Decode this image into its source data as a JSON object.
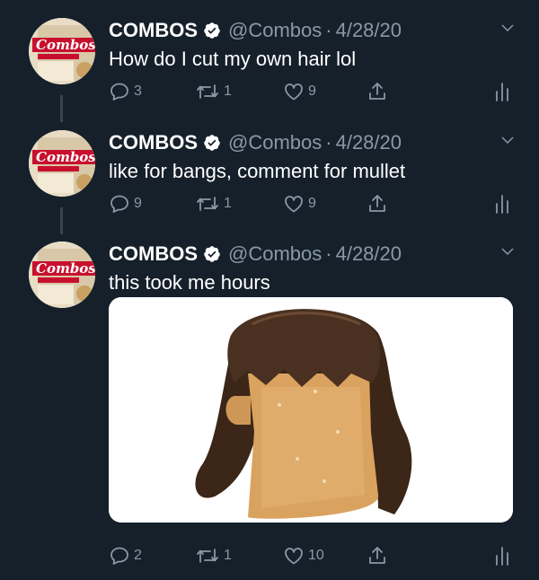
{
  "colors": {
    "background": "#15202b",
    "primary_text": "#ffffff",
    "secondary_text": "#8899a6",
    "verified_badge": "#ffffff",
    "thread_line": "#38444d"
  },
  "avatar": {
    "brand_text": "Combos",
    "sub_text": "STUFFED SNACKS",
    "flavor_text": "Spicy Honey Mustard"
  },
  "tweets": [
    {
      "name": "COMBOS",
      "handle": "@Combos",
      "separator": "·",
      "date": "4/28/20",
      "text": "How do I cut my own hair lol",
      "replies": "3",
      "retweets": "1",
      "likes": "9"
    },
    {
      "name": "COMBOS",
      "handle": "@Combos",
      "separator": "·",
      "date": "4/28/20",
      "text": "like for bangs, comment for mullet",
      "replies": "9",
      "retweets": "1",
      "likes": "9"
    },
    {
      "name": "COMBOS",
      "handle": "@Combos",
      "separator": "·",
      "date": "4/28/20",
      "text": "this took me hours",
      "replies": "2",
      "retweets": "1",
      "likes": "10"
    }
  ]
}
